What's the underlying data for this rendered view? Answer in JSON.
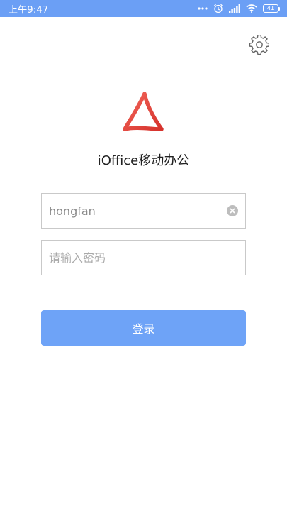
{
  "status_bar": {
    "time": "上午9:47",
    "battery": "41",
    "icons": [
      "more-dots-icon",
      "alarm-icon",
      "signal-icon",
      "wifi-icon",
      "battery-icon"
    ]
  },
  "header": {
    "settings_icon": "gear-icon"
  },
  "app": {
    "logo_icon": "triangle-logo-icon",
    "title": "iOffice移动办公"
  },
  "form": {
    "username_value": "hongfan",
    "clear_icon": "clear-icon",
    "password_placeholder": "请输入密码",
    "login_label": "登录"
  },
  "colors": {
    "status_bar": "#6b9ff5",
    "button": "#6ea3f7",
    "logo": "#e8403a"
  }
}
